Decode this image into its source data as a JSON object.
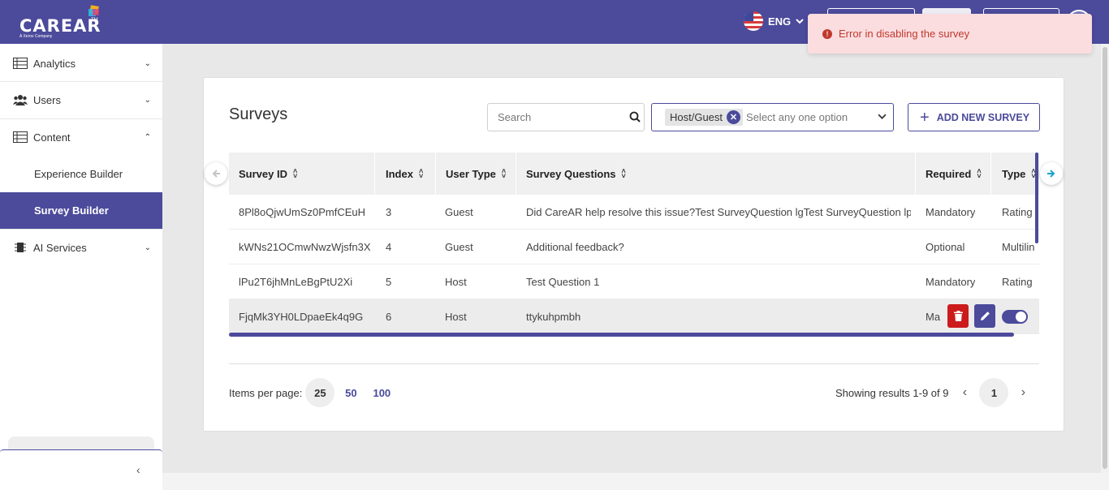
{
  "brand": {
    "name": "CAREAR",
    "trademark": "TM",
    "tagline": "A Xerox Company"
  },
  "header": {
    "language": "ENG"
  },
  "toast": {
    "message": "Error in disabling the survey",
    "icon": "info-icon"
  },
  "sidebar": {
    "items": [
      {
        "label": "Analytics",
        "icon": "table-icon",
        "expanded": false
      },
      {
        "label": "Users",
        "icon": "users-icon",
        "expanded": false
      },
      {
        "label": "Content",
        "icon": "table-icon",
        "expanded": true,
        "children": [
          {
            "label": "Experience Builder",
            "active": false
          },
          {
            "label": "Survey Builder",
            "active": true
          }
        ]
      },
      {
        "label": "AI Services",
        "icon": "chip-icon",
        "expanded": false
      }
    ],
    "collapse_icon": "chevron-left-icon"
  },
  "surveys": {
    "title": "Surveys",
    "search": {
      "placeholder": "Search",
      "value": ""
    },
    "filter": {
      "chip": "Host/Guest",
      "placeholder": "Select any one option"
    },
    "add_button": "ADD NEW SURVEY",
    "columns": [
      "Survey ID",
      "Index",
      "User Type",
      "Survey Questions",
      "Required",
      "Type"
    ],
    "rows": [
      {
        "id": "8Pl8oQjwUmSz0PmfCEuH",
        "index": "3",
        "user_type": "Guest",
        "question": "Did CareAR help resolve this issue?Test SurveyQuestion lgTest SurveyQuestion lp",
        "required": "Mandatory",
        "type": "Rating"
      },
      {
        "id": "kWNs21OCmwNwzWjsfn3X",
        "index": "4",
        "user_type": "Guest",
        "question": "Additional feedback?",
        "required": "Optional",
        "type": "Multilin"
      },
      {
        "id": "lPu2T6jhMnLeBgPtU2Xi",
        "index": "5",
        "user_type": "Host",
        "question": "Test Question 1",
        "required": "Mandatory",
        "type": "Rating"
      },
      {
        "id": "FjqMk3YH0LDpaeEk4q9G",
        "index": "6",
        "user_type": "Host",
        "question": "ttykuhpmbh",
        "required": "Ma",
        "type": "",
        "enabled": true
      }
    ]
  },
  "pagination": {
    "items_per_page_label": "Items per page:",
    "options": [
      "25",
      "50",
      "100"
    ],
    "selected": "25",
    "summary": "Showing results 1-9 of 9",
    "current_page": "1"
  },
  "colors": {
    "primary": "#4b4a9b",
    "danger": "#cc1b1b",
    "toast_bg": "#fbdde0",
    "toast_text": "#c0392b",
    "accent": "#1aa3c9"
  }
}
